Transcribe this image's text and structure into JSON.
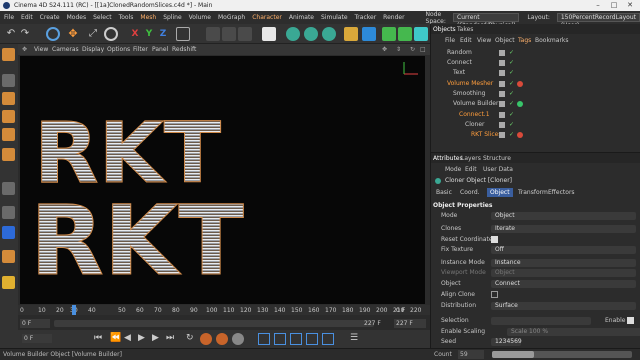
{
  "window": {
    "title": "Cinema 4D S24.111 (RC) - [[1a]ClonedRandomSlices.c4d *] - Main"
  },
  "menu": {
    "items": [
      "File",
      "Edit",
      "Create",
      "Modes",
      "Select",
      "Tools",
      "Mesh",
      "Spline",
      "Volume",
      "MoGraph",
      "Character",
      "Animate",
      "Simulate",
      "Tracker",
      "Render"
    ],
    "node_space_label": "Node Space:",
    "node_space_value": "Current (Standard/Physical)",
    "layout_label": "Layout:",
    "layout_value": "150PercentRecordLayout (User)"
  },
  "viewport": {
    "menu": [
      "View",
      "Cameras",
      "Display",
      "Options",
      "Filter",
      "Panel",
      "Redshift"
    ],
    "scene_text": "RKT"
  },
  "timeline": {
    "ticks": [
      "0",
      "10",
      "20",
      "30",
      "40",
      "50",
      "60",
      "70",
      "80",
      "90",
      "100",
      "110",
      "120",
      "130",
      "140",
      "150",
      "160",
      "170",
      "180",
      "190",
      "200",
      "210",
      "220"
    ],
    "current_frame": "0 F",
    "start": "0 F",
    "end_a": "227 F",
    "end_b": "227 F",
    "frame_marker": "0 F"
  },
  "objects": {
    "tabs": [
      "Objects",
      "Takes"
    ],
    "menu": [
      "File",
      "Edit",
      "View",
      "Object",
      "Tags",
      "Bookmarks"
    ],
    "rows": [
      {
        "name": "Random",
        "indent": 0
      },
      {
        "name": "Connect",
        "indent": 0
      },
      {
        "name": "Text",
        "indent": 1
      },
      {
        "name": "Volume Mesher",
        "indent": 0
      },
      {
        "name": "Smoothing",
        "indent": 1
      },
      {
        "name": "Volume Builder",
        "indent": 1
      },
      {
        "name": "Connect.1",
        "indent": 2
      },
      {
        "name": "Cloner",
        "indent": 3
      },
      {
        "name": "RKT Slices",
        "indent": 4
      }
    ]
  },
  "attributes": {
    "tabs": [
      "Attributes",
      "Layers",
      "Structure"
    ],
    "menu": [
      "Mode",
      "Edit",
      "User Data"
    ],
    "object_title": "Cloner Object [Cloner]",
    "subtabs": [
      "Basic",
      "Coord.",
      "Object",
      "Transform",
      "Effectors"
    ],
    "section": "Object Properties",
    "rows": [
      {
        "label": "Mode",
        "value": "Object"
      },
      {
        "label": "Clones",
        "value": "Iterate"
      },
      {
        "label": "Reset Coordinates",
        "value": ""
      },
      {
        "label": "Fix Texture",
        "value": "Off"
      },
      {
        "label": "Instance Mode",
        "value": "Instance"
      },
      {
        "label": "Viewport Mode",
        "value": "Object"
      },
      {
        "label": "Object",
        "value": "Connect"
      },
      {
        "label": "Align Clone",
        "value": ""
      },
      {
        "label": "Distribution",
        "value": "Surface"
      },
      {
        "label": "Selection",
        "value": ""
      },
      {
        "label": "Enable Scaling",
        "value": "Scale 100 %"
      },
      {
        "label": "Seed",
        "value": "1234569"
      },
      {
        "label": "Count",
        "value": "59"
      }
    ],
    "enable_label": "Enable"
  },
  "status": {
    "text": "Volume Builder Object [Volume Builder]"
  },
  "colors": {
    "accent": "#ff9d3c",
    "tag_red": "#d94a3a",
    "tag_green": "#38c56a"
  }
}
